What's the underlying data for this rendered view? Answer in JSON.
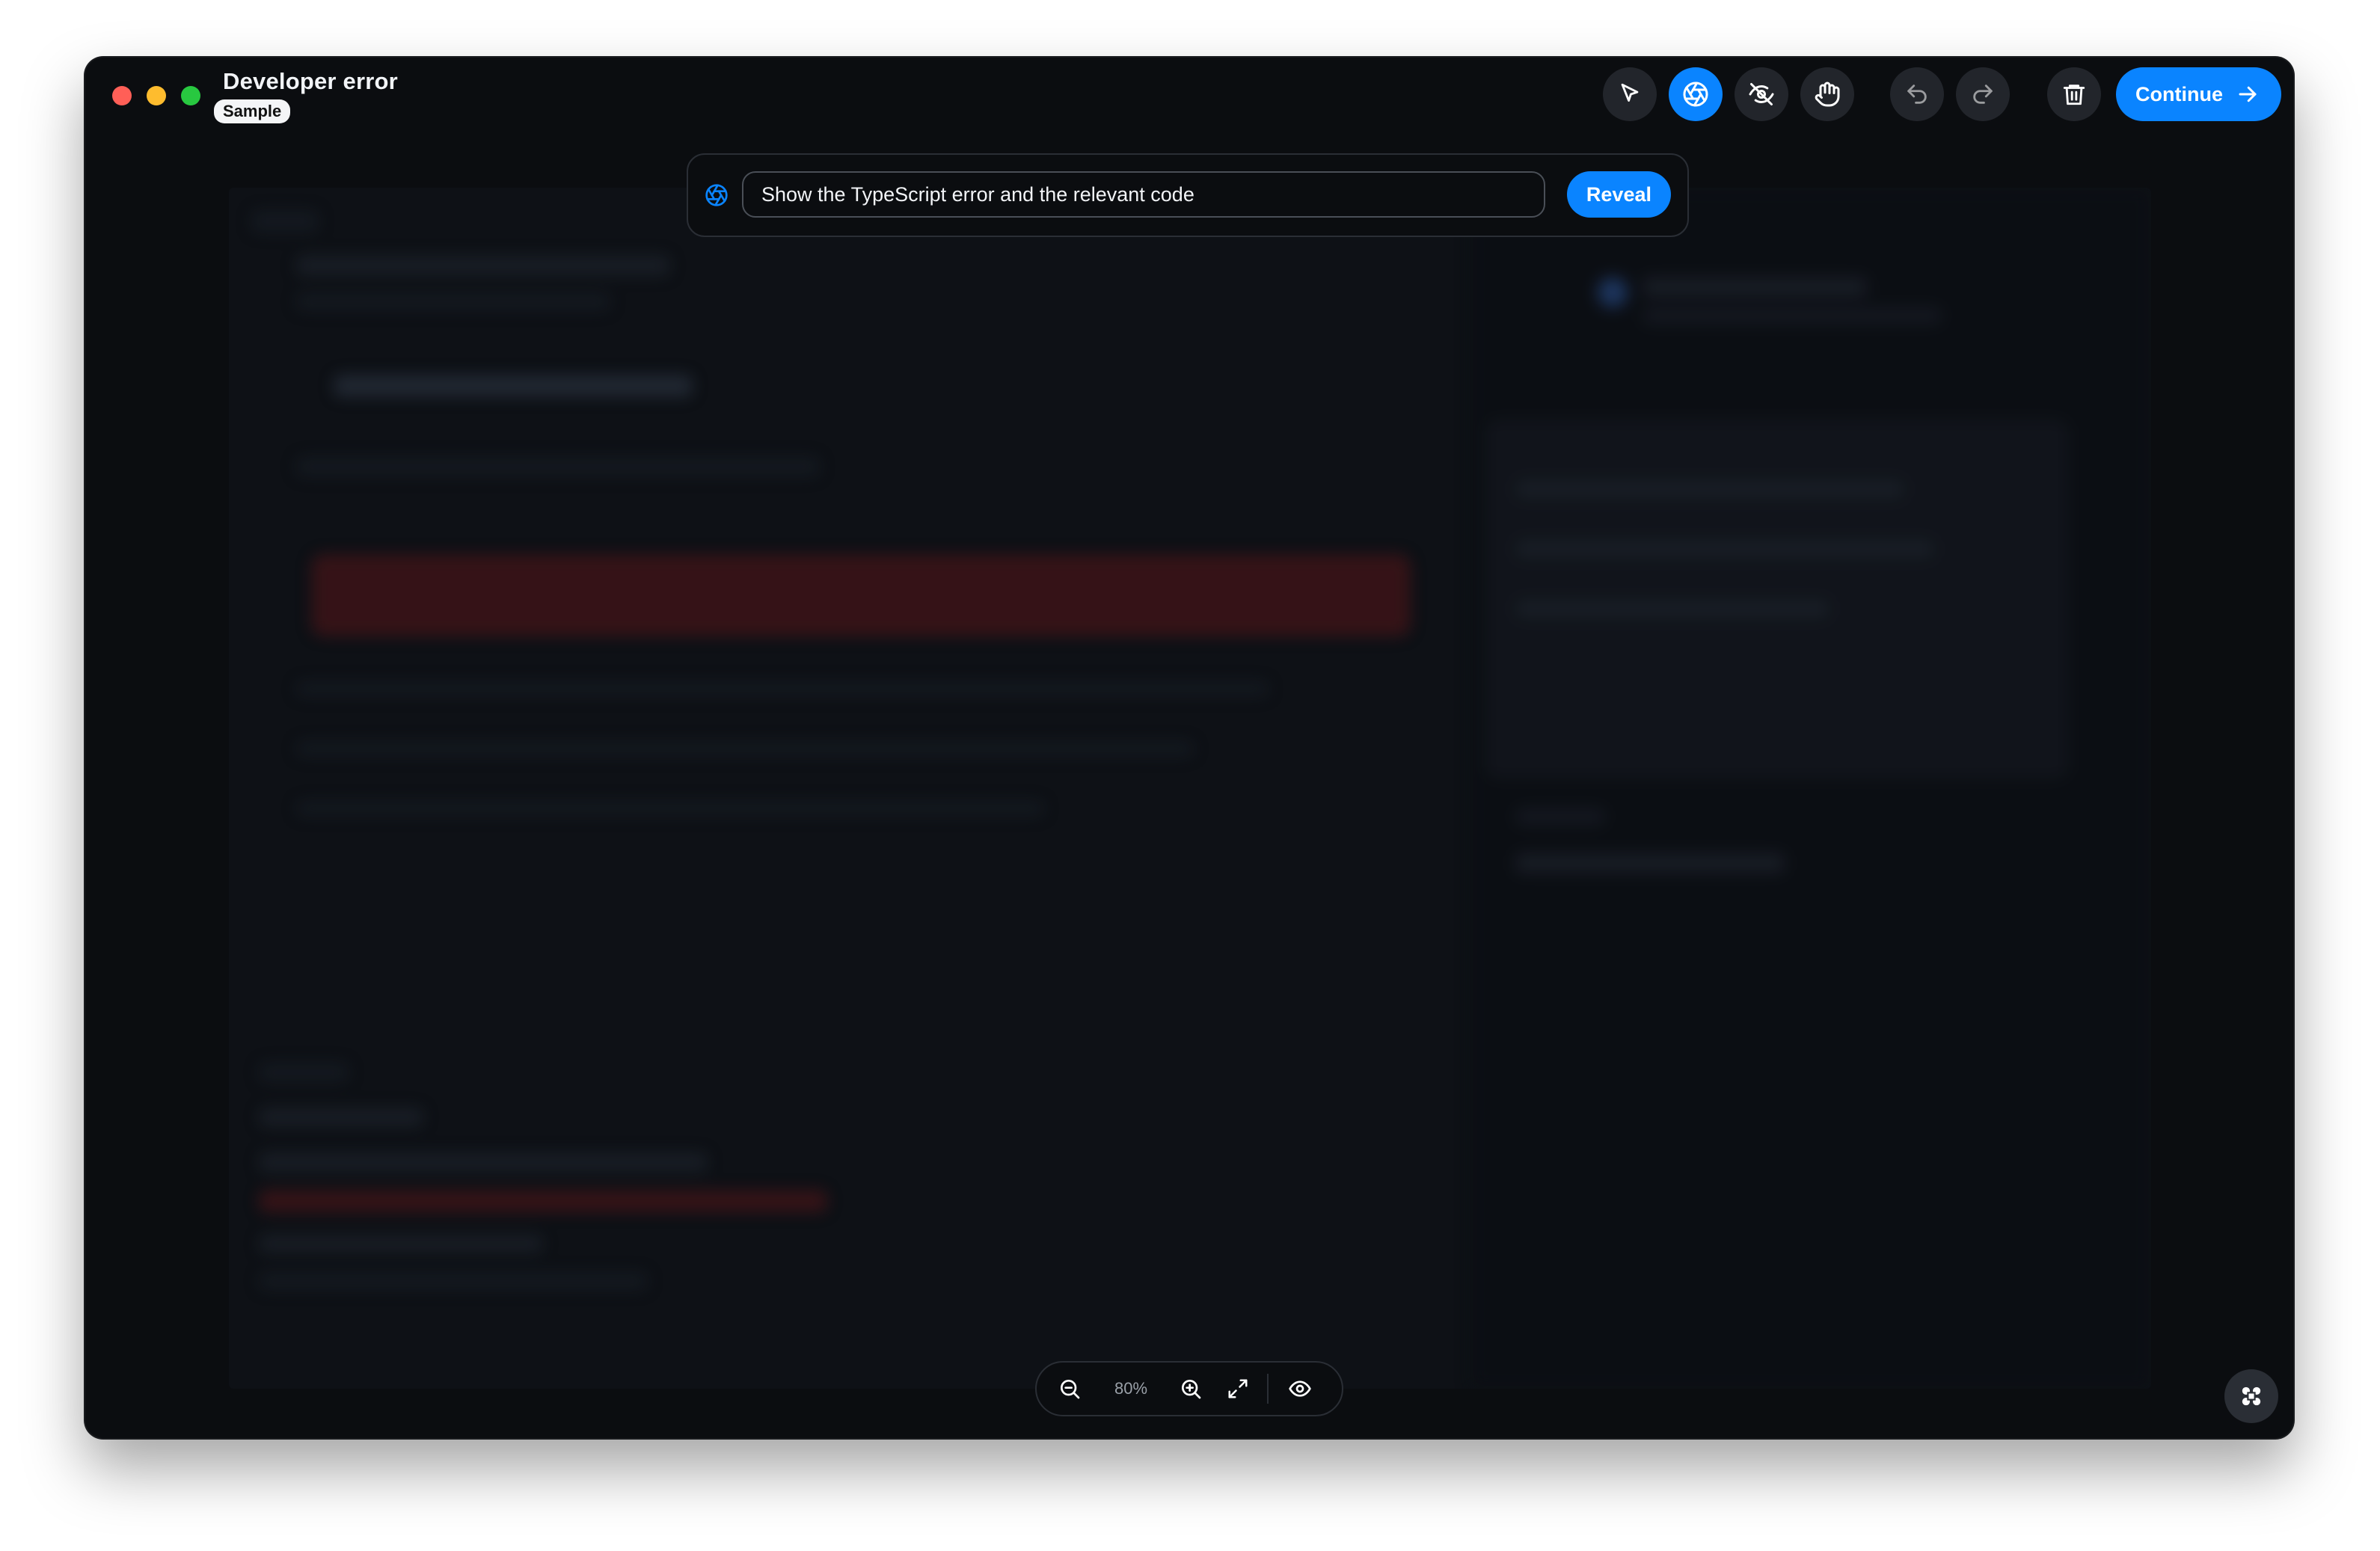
{
  "window": {
    "title": "Developer error",
    "badge": "Sample"
  },
  "toolbar": {
    "tools": [
      {
        "name": "select-tool",
        "icon": "cursor-arrow-icon",
        "active": false
      },
      {
        "name": "reveal-tool",
        "icon": "aperture-icon",
        "active": true
      },
      {
        "name": "hide-tool",
        "icon": "eye-off-icon",
        "active": false
      },
      {
        "name": "pan-tool",
        "icon": "hand-icon",
        "active": false
      }
    ],
    "undo_icon": "undo-icon",
    "redo_icon": "redo-icon",
    "delete_icon": "trash-icon",
    "continue_label": "Continue",
    "continue_icon": "arrow-right-icon"
  },
  "prompt": {
    "value": "Show the TypeScript error and the relevant code",
    "reveal_label": "Reveal",
    "icon": "aperture-icon"
  },
  "zoom": {
    "level": "80%",
    "icons": [
      "zoom-out-icon",
      "zoom-in-icon",
      "expand-icon",
      "eye-icon"
    ]
  },
  "corner": {
    "icon": "command-icon"
  },
  "colors": {
    "accent": "#0a84ff",
    "window_bg": "#0b0d10",
    "button_bg": "#22252b"
  }
}
